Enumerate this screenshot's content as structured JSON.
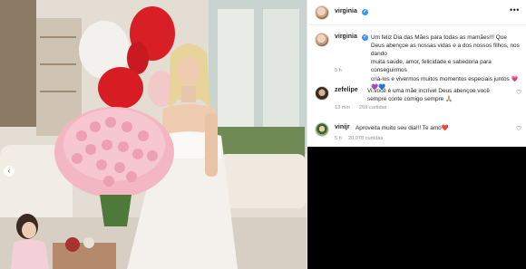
{
  "post": {
    "username": "virginia",
    "more_icon": "more-icon",
    "caption_user": "virginia",
    "caption": "Um feliz Dia das Mães para todas as mamães!!! Que\nDeus abençoe as nossas vidas e a dos nossos filhos, nos dando\nmuita saúde, amor, felicidade e sabedoria para conseguirmos\ncriá-los e vivermos muitos momentos especiais juntos 💗💜💙",
    "caption_time": "5 h"
  },
  "comments": [
    {
      "username": "zefelipe",
      "text": "Vi.você é uma mãe incrível Deus abençoe você\nsempre conte comigo sempre 🙏🏼",
      "time": "13 min",
      "likes": "259 curtidas"
    },
    {
      "username": "vinijr",
      "text": "Aproveita muito seu dia!!! Te amo❤️",
      "time": "5 h",
      "likes": "20.078 curtidas"
    }
  ],
  "colors": {
    "accent": "#3897f0",
    "text": "#262626",
    "muted": "#8e8e8e"
  }
}
